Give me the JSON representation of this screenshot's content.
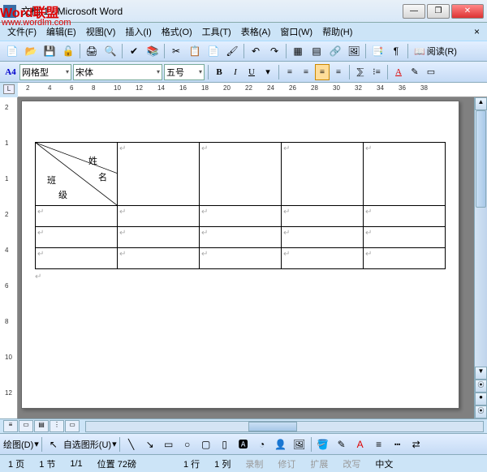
{
  "watermark": {
    "line1": "Word联盟",
    "line2": "www.wordlm.com"
  },
  "title": "文档 1 - Microsoft Word",
  "menus": [
    {
      "label": "文件(F)"
    },
    {
      "label": "编辑(E)"
    },
    {
      "label": "视图(V)"
    },
    {
      "label": "插入(I)"
    },
    {
      "label": "格式(O)"
    },
    {
      "label": "工具(T)"
    },
    {
      "label": "表格(A)"
    },
    {
      "label": "窗口(W)"
    },
    {
      "label": "帮助(H)"
    }
  ],
  "toolbar1": {
    "readmode": "阅读(R)"
  },
  "formatbar": {
    "a4": "A4",
    "style": "网格型",
    "font": "宋体",
    "size": "五号",
    "b": "B",
    "i": "I",
    "u": "U",
    "a": "A"
  },
  "ruler_h": [
    "2",
    "4",
    "6",
    "8",
    "10",
    "12",
    "14",
    "16",
    "18",
    "20",
    "22",
    "24",
    "26",
    "28",
    "30",
    "32",
    "34",
    "36",
    "38"
  ],
  "ruler_v": [
    "2",
    "1",
    "1",
    "2",
    "4",
    "6",
    "8",
    "10",
    "12"
  ],
  "diag_cell": {
    "tl1": "姓",
    "tl2": "名",
    "bl1": "班",
    "bl2": "级"
  },
  "drawbar": {
    "label": "绘图(D)",
    "autoshape": "自选图形(U)"
  },
  "status": {
    "page": "1 页",
    "section": "1 节",
    "pageof": "1/1",
    "pos": "位置 72磅",
    "line": "1 行",
    "col": "1 列",
    "rec": "录制",
    "rev": "修订",
    "ext": "扩展",
    "ovr": "改写",
    "lang": "中文"
  },
  "winbtns": {
    "min": "—",
    "max": "❐",
    "close": "✕"
  }
}
